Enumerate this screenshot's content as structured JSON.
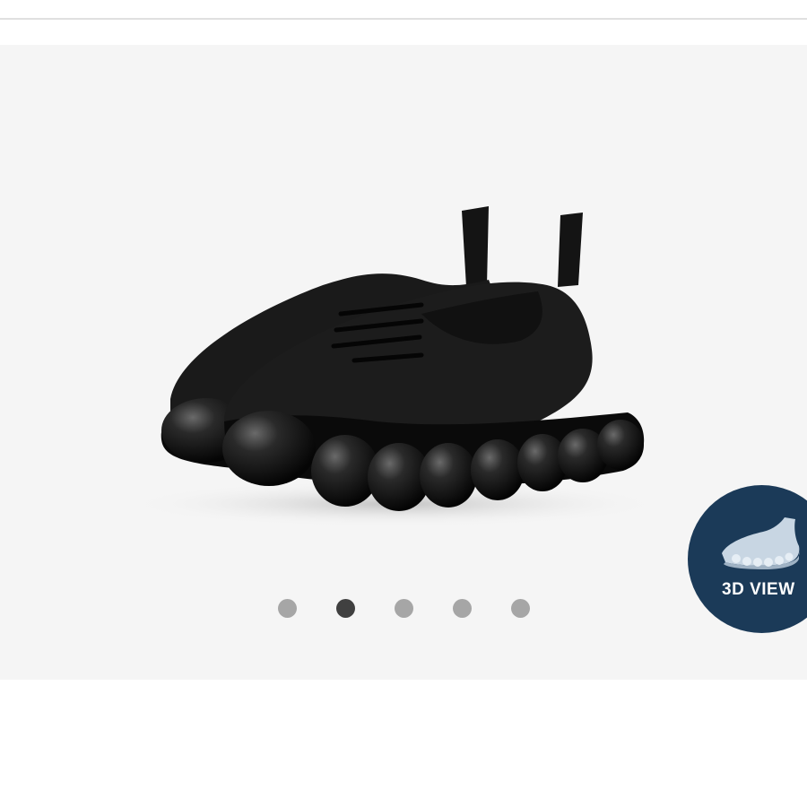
{
  "gallery": {
    "image_name": "black-knit-sneakers-bubble-sole",
    "slide_count": 5,
    "active_slide": 2
  },
  "view3d": {
    "label": "3D VIEW",
    "icon": "3d-shoe-icon",
    "color": "#1b3a58"
  },
  "colors": {
    "dot_inactive": "#a6a6a6",
    "dot_active": "#404040",
    "gallery_bg": "#f5f5f5"
  }
}
